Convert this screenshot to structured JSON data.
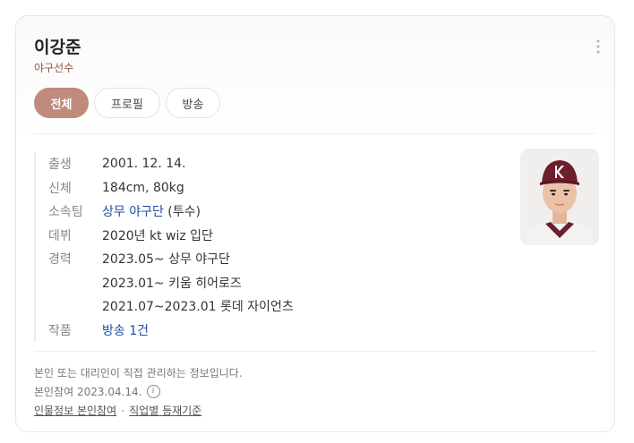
{
  "profile": {
    "name": "이강준",
    "occupation": "야구선수"
  },
  "tabs": [
    {
      "label": "전체",
      "active": true
    },
    {
      "label": "프로필",
      "active": false
    },
    {
      "label": "방송",
      "active": false
    }
  ],
  "info": {
    "birth_label": "출생",
    "birth_value": "2001. 12. 14.",
    "body_label": "신체",
    "body_value": "184cm, 80kg",
    "team_label": "소속팀",
    "team_link": "상무 야구단",
    "team_suffix": " (투수)",
    "debut_label": "데뷔",
    "debut_value": "2020년 kt wiz 입단",
    "career_label": "경력",
    "career": [
      "2023.05~ 상무 야구단",
      "2023.01~ 키움 히어로즈",
      "2021.07~2023.01 롯데 자이언츠"
    ],
    "works_label": "작품",
    "works_link": "방송 1건"
  },
  "footer": {
    "notice": "본인 또는 대리인이 직접 관리하는 정보입니다.",
    "participation": "본인참여 2023.04.14.",
    "link_participate": "인물정보 본인참여",
    "link_criteria": "직업별 등재기준"
  },
  "colors": {
    "accent": "#c08a7d",
    "link": "#1e50a2",
    "occupation": "#8a5a4c"
  }
}
